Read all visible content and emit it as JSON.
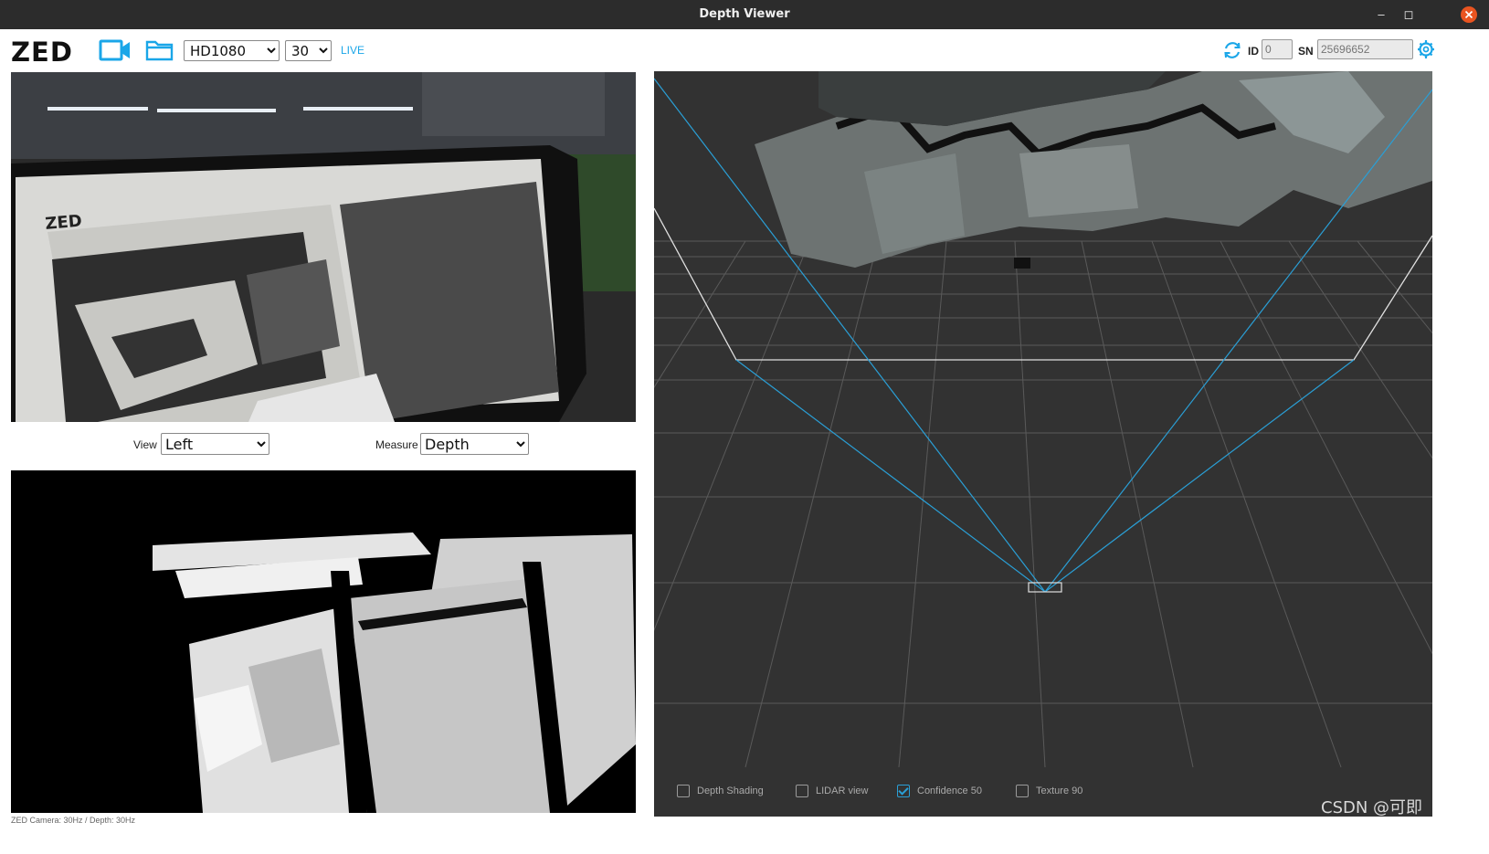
{
  "window": {
    "title": "Depth Viewer",
    "min_glyph": "–",
    "max_glyph": "◻"
  },
  "toolbar": {
    "logo": "ZED",
    "camera_icon": "video-camera-icon",
    "folder_icon": "folder-icon",
    "resolution": {
      "selected": "HD1080",
      "options": [
        "HD1080"
      ]
    },
    "fps": {
      "selected": "30",
      "options": [
        "30"
      ]
    },
    "live_label": "LIVE",
    "refresh_icon": "refresh-icon",
    "id_label": "ID",
    "id_placeholder": "0",
    "sn_label": "SN",
    "sn_placeholder": "25696652",
    "settings_icon": "gear-icon",
    "accent_color": "#1aa6e8"
  },
  "view_controls": {
    "view_label": "View",
    "view_selected": "Left",
    "view_options": [
      "Left"
    ],
    "measure_label": "Measure",
    "measure_selected": "Depth",
    "measure_options": [
      "Depth"
    ]
  },
  "status": {
    "text": "ZED Camera: 30Hz / Depth: 30Hz"
  },
  "point_cloud": {
    "options": [
      {
        "label": "Depth Shading",
        "checked": false
      },
      {
        "label": "LIDAR view",
        "checked": false
      },
      {
        "label": "Confidence 50",
        "checked": true
      },
      {
        "label": "Texture 90",
        "checked": false
      }
    ]
  },
  "watermark": "CSDN @可即"
}
